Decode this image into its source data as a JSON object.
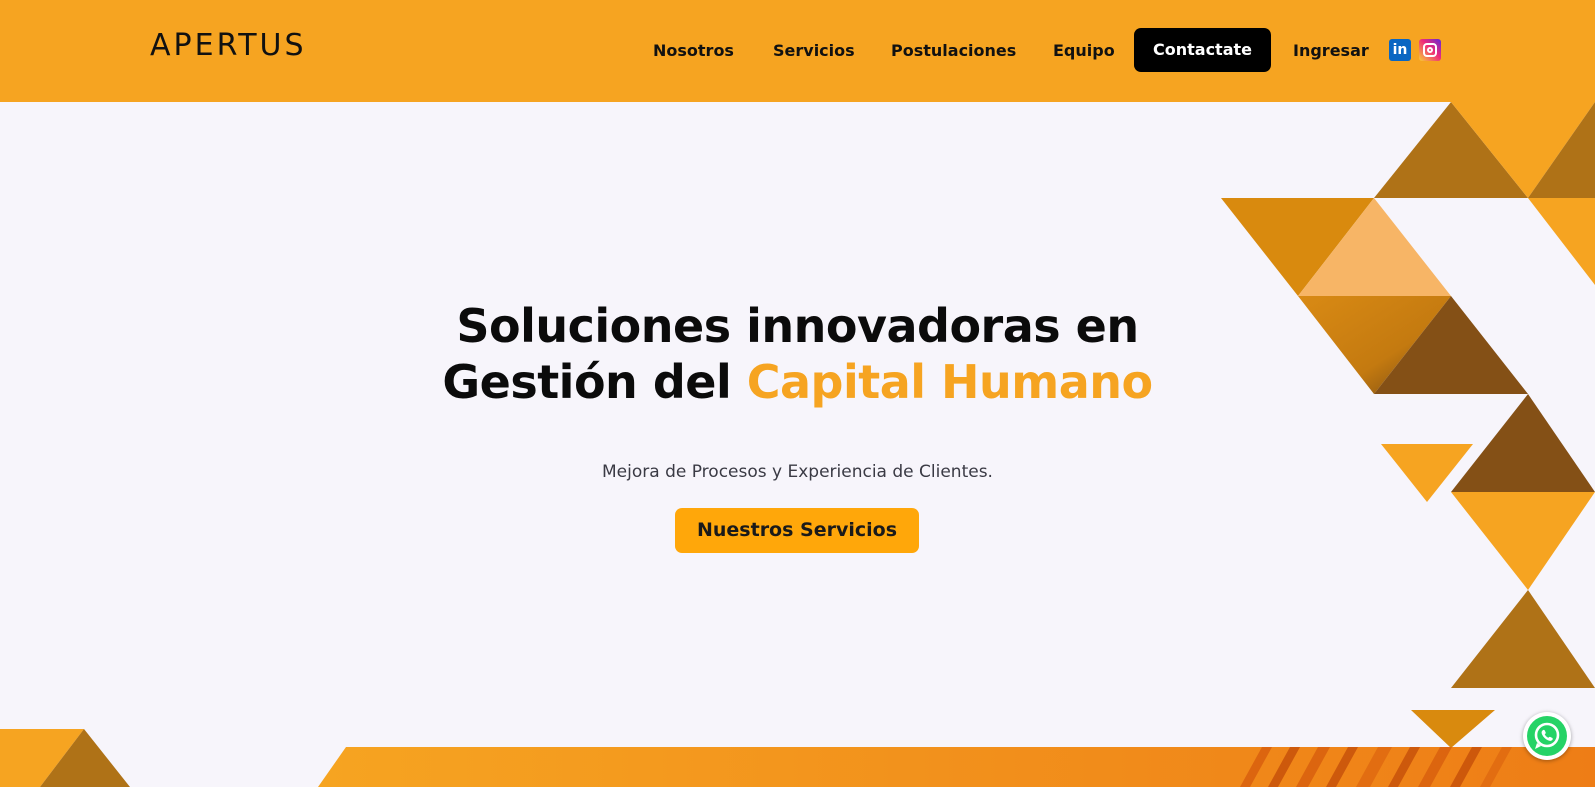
{
  "header": {
    "logo_text": "APERTUS",
    "nav": {
      "nosotros": "Nosotros",
      "servicios": "Servicios",
      "postulaciones": "Postulaciones",
      "equipo": "Equipo",
      "contactate": "Contactate",
      "ingresar": "Ingresar"
    },
    "social": {
      "linkedin": "in",
      "linkedin_icon": "linkedin-icon",
      "instagram_icon": "instagram-icon"
    }
  },
  "hero": {
    "title_line1": "Soluciones innovadoras en",
    "title_line2_plain": "Gestión del ",
    "title_line2_accent": "Capital Humano",
    "subtitle": "Mejora de Procesos y Experiencia de Clientes.",
    "cta_label": "Nuestros Servicios"
  },
  "floating": {
    "whatsapp_icon": "whatsapp-icon"
  },
  "colors": {
    "brand_orange": "#f6a421",
    "cta_orange": "#ffa70a",
    "dark_text": "#0b0b0b",
    "background": "#f7f5fb"
  }
}
